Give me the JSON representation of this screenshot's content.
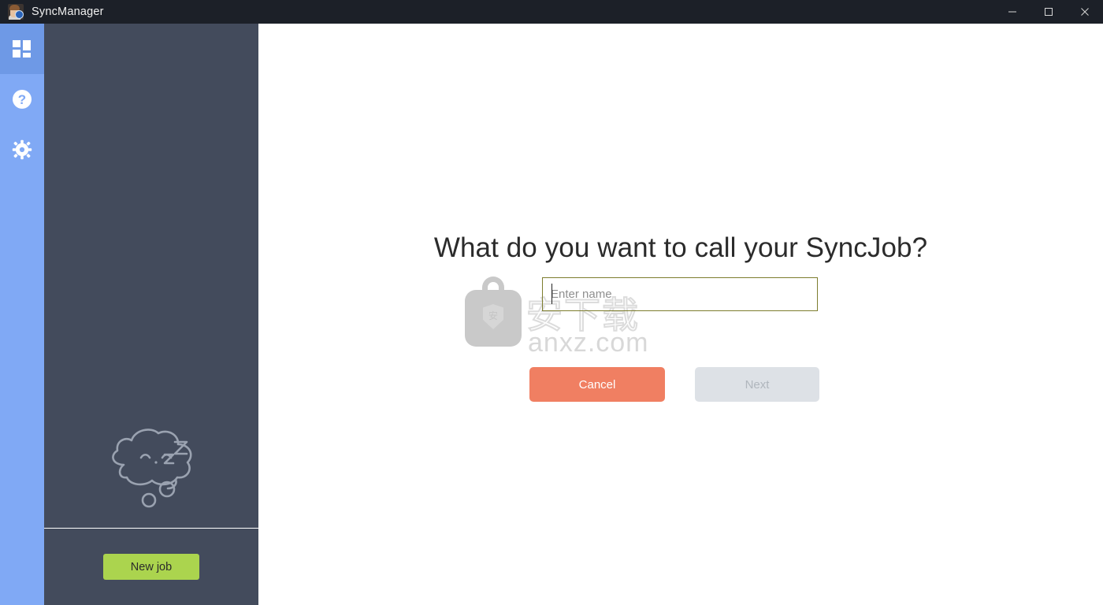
{
  "window": {
    "title": "SyncManager",
    "app_icon": "syncmanager-app-icon",
    "controls": {
      "minimize": "minimize-icon",
      "maximize": "maximize-icon",
      "close": "close-icon"
    }
  },
  "rail": {
    "items": [
      {
        "icon": "dashboard-grid-icon",
        "name": "dashboard",
        "active": true
      },
      {
        "icon": "help-question-icon",
        "name": "help",
        "active": false
      },
      {
        "icon": "settings-gear-icon",
        "name": "settings",
        "active": false
      }
    ]
  },
  "jobs_panel": {
    "empty_state_art": "sleeping-cloud-icon",
    "jobs": [],
    "new_job_label": "New job"
  },
  "main": {
    "headline": "What do you want to call your SyncJob?",
    "name_input": {
      "value": "",
      "placeholder": "Enter name",
      "focused": true
    },
    "cancel_label": "Cancel",
    "next_label": "Next"
  },
  "watermark": {
    "cjk_text": "安下载",
    "domain": "anxz.com",
    "bag_icon": "watermark-bag-icon"
  },
  "colors": {
    "titlebar": "#1c2028",
    "rail": "#80a9f5",
    "rail_active": "#6e99e6",
    "jobs_panel": "#434b5c",
    "new_job": "#abd44e",
    "cancel": "#f07f62",
    "next_disabled": "#dde1e6",
    "input_border": "#7d7d2e"
  }
}
